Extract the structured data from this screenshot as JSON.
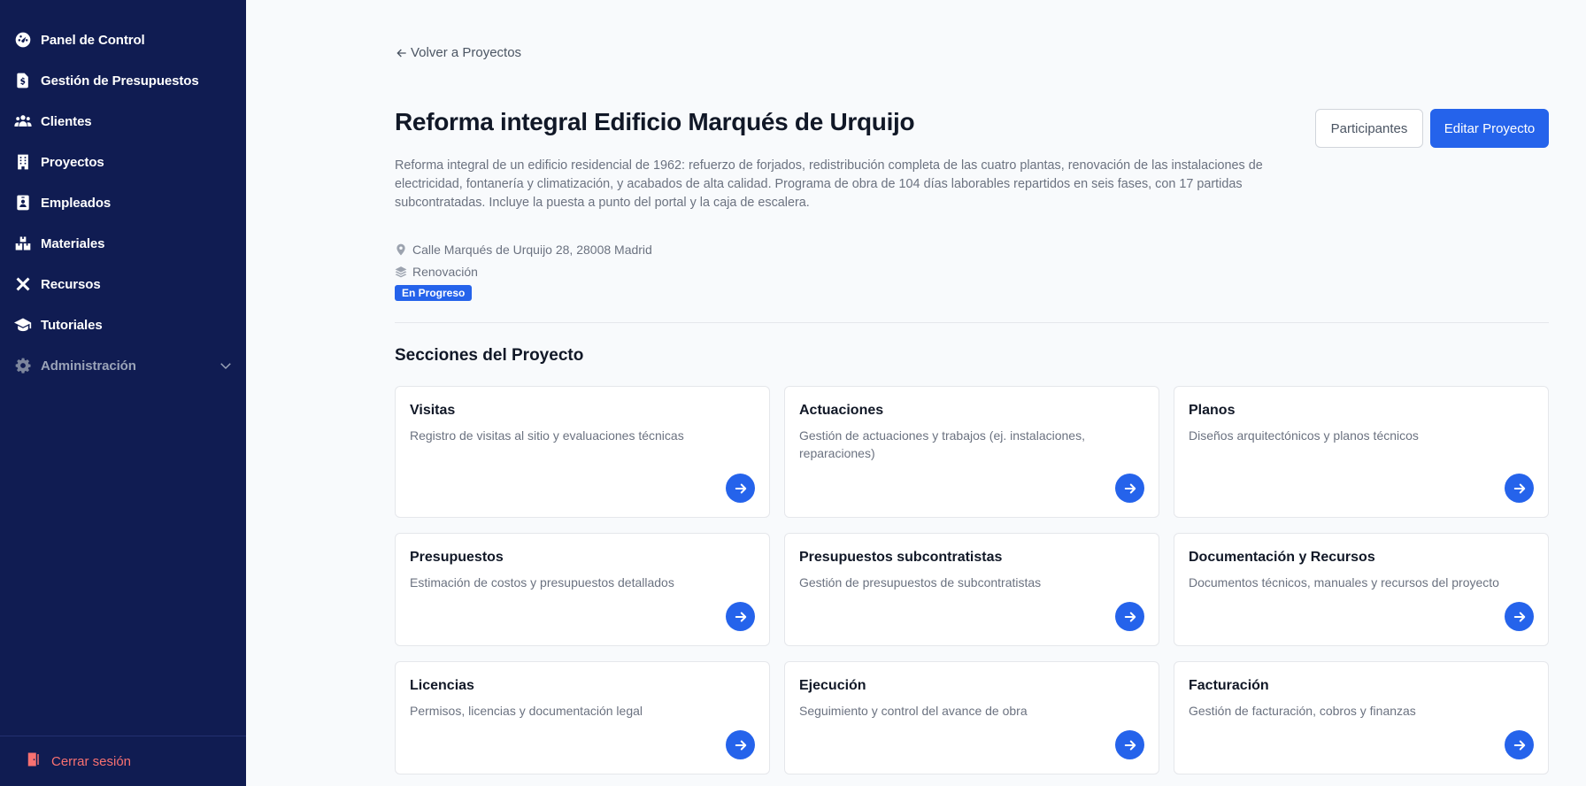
{
  "sidebar": {
    "items": [
      {
        "label": "Panel de Control",
        "icon": "gauge-icon"
      },
      {
        "label": "Gestión de Presupuestos",
        "icon": "invoice-dollar-icon"
      },
      {
        "label": "Clientes",
        "icon": "users-icon"
      },
      {
        "label": "Proyectos",
        "icon": "building-icon"
      },
      {
        "label": "Empleados",
        "icon": "id-badge-icon"
      },
      {
        "label": "Materiales",
        "icon": "boxes-icon"
      },
      {
        "label": "Recursos",
        "icon": "tools-icon"
      },
      {
        "label": "Tutoriales",
        "icon": "graduation-cap-icon"
      }
    ],
    "admin": {
      "label": "Administración",
      "icon": "gear-icon"
    },
    "logout": {
      "label": "Cerrar sesión",
      "icon": "door-exit-icon"
    }
  },
  "header": {
    "back_label": "Volver a Proyectos",
    "title": "Reforma integral Edificio Marqués de Urquijo",
    "participants_label": "Participantes",
    "edit_label": "Editar Proyecto"
  },
  "project": {
    "description": "Reforma integral de un edificio residencial de 1962: refuerzo de forjados, redistribución completa de las cuatro plantas, renovación de las instalaciones de electricidad, fontanería y climatización, y acabados de alta calidad. Programa de obra de 104 días laborables repartidos en seis fases, con 17 partidas subcontratadas. Incluye la puesta a punto del portal y la caja de escalera.",
    "address": "Calle Marqués de Urquijo 28, 28008 Madrid",
    "type": "Renovación",
    "status": "En Progreso"
  },
  "sections": {
    "title": "Secciones del Proyecto",
    "cards": [
      {
        "title": "Visitas",
        "description": "Registro de visitas al sitio y evaluaciones técnicas"
      },
      {
        "title": "Actuaciones",
        "description": "Gestión de actuaciones y trabajos (ej. instalaciones, reparaciones)"
      },
      {
        "title": "Planos",
        "description": "Diseños arquitectónicos y planos técnicos"
      },
      {
        "title": "Presupuestos",
        "description": "Estimación de costos y presupuestos detallados"
      },
      {
        "title": "Presupuestos subcontratistas",
        "description": "Gestión de presupuestos de subcontratistas"
      },
      {
        "title": "Documentación y Recursos",
        "description": "Documentos técnicos, manuales y recursos del proyecto"
      },
      {
        "title": "Licencias",
        "description": "Permisos, licencias y documentación legal"
      },
      {
        "title": "Ejecución",
        "description": "Seguimiento y control del avance de obra"
      },
      {
        "title": "Facturación",
        "description": "Gestión de facturación, cobros y finanzas"
      }
    ]
  },
  "colors": {
    "sidebar_bg": "#101c52",
    "accent": "#2563eb",
    "logout": "#f87171"
  }
}
